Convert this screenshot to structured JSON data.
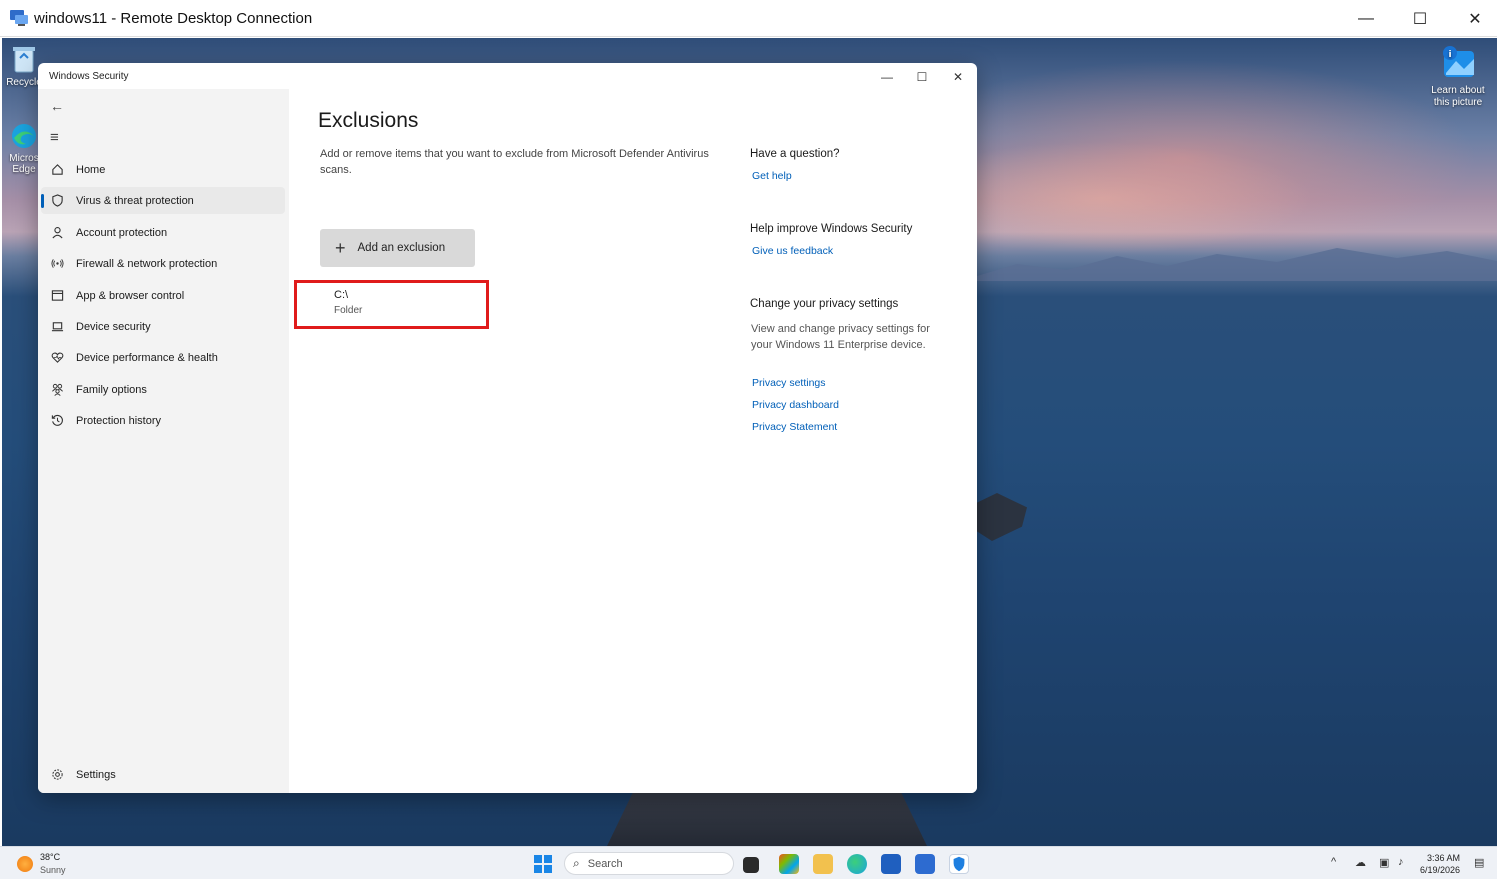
{
  "rdp": {
    "title": "windows11 - Remote Desktop Connection",
    "minimize": "—",
    "maximize": "☐",
    "close": "✕"
  },
  "desktop": {
    "icons": [
      {
        "label": "Recycle",
        "icon": "recycle-bin-icon"
      },
      {
        "label": "Micros Edge",
        "icon": "edge-icon"
      }
    ],
    "learn_about": "Learn about this picture"
  },
  "window": {
    "title": "Windows Security",
    "minimize": "—",
    "maximize": "☐",
    "close": "✕"
  },
  "sidebar": {
    "back": "←",
    "menu": "≡",
    "items": [
      {
        "label": "Home",
        "icon": "home-icon"
      },
      {
        "label": "Virus & threat protection",
        "icon": "shield-icon",
        "active": true
      },
      {
        "label": "Account protection",
        "icon": "person-icon"
      },
      {
        "label": "Firewall & network protection",
        "icon": "wifi-icon"
      },
      {
        "label": "App & browser control",
        "icon": "app-window-icon"
      },
      {
        "label": "Device security",
        "icon": "laptop-icon"
      },
      {
        "label": "Device performance & health",
        "icon": "heart-icon"
      },
      {
        "label": "Family options",
        "icon": "family-icon"
      },
      {
        "label": "Protection history",
        "icon": "history-icon"
      }
    ],
    "settings": {
      "label": "Settings",
      "icon": "gear-icon"
    }
  },
  "main": {
    "title": "Exclusions",
    "description": "Add or remove items that you want to exclude from Microsoft Defender Antivirus scans.",
    "add_button": "Add an exclusion",
    "exclusions": [
      {
        "path": "C:\\",
        "type": "Folder"
      }
    ]
  },
  "side_panel": {
    "question_head": "Have a question?",
    "get_help": "Get help",
    "improve_head": "Help improve Windows Security",
    "feedback": "Give us feedback",
    "privacy_head": "Change your privacy settings",
    "privacy_text": "View and change privacy settings for your Windows 11 Enterprise device.",
    "privacy_settings": "Privacy settings",
    "privacy_dashboard": "Privacy dashboard",
    "privacy_statement": "Privacy Statement"
  },
  "taskbar": {
    "weather_temp": "38°C",
    "weather_cond": "Sunny",
    "search_placeholder": "Search",
    "time": "3:36 AM",
    "date": "6/19/2026"
  },
  "colors": {
    "accent": "#005fb8",
    "highlight_box": "#e01b1b"
  }
}
